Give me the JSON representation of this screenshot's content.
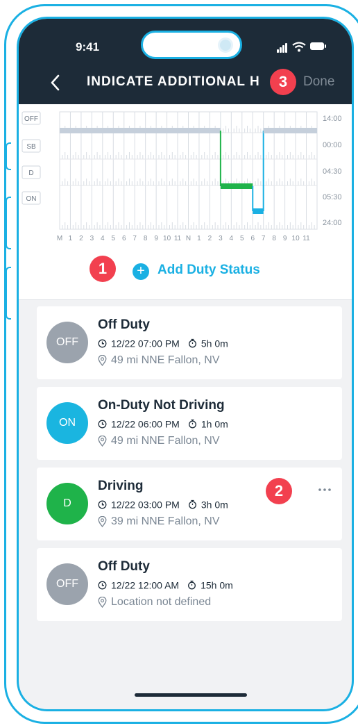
{
  "status_bar": {
    "time": "9:41"
  },
  "nav": {
    "title": "INDICATE ADDITIONAL H",
    "done_label": "Done"
  },
  "badges": [
    "1",
    "2",
    "3"
  ],
  "chart_data": {
    "type": "duty-log",
    "row_labels": [
      "OFF",
      "SB",
      "D",
      "ON"
    ],
    "totals": [
      "14:00",
      "00:00",
      "04:30",
      "05:30",
      "24:00"
    ],
    "x_labels": [
      "M",
      "1",
      "2",
      "3",
      "4",
      "5",
      "6",
      "7",
      "8",
      "9",
      "10",
      "11",
      "N",
      "1",
      "2",
      "3",
      "4",
      "5",
      "6",
      "7",
      "8",
      "9",
      "10",
      "11"
    ],
    "x_range": [
      0,
      24
    ],
    "segments": [
      {
        "status": "OFF",
        "start": 0,
        "end": 15
      },
      {
        "status": "D",
        "start": 15,
        "end": 18
      },
      {
        "status": "ON",
        "start": 18,
        "end": 19
      },
      {
        "status": "OFF",
        "start": 19,
        "end": 24
      }
    ],
    "colors": {
      "OFF": "#c5cfdb",
      "D": "#1fb34a",
      "ON": "#1ab0e3",
      "connector_d": "#1fb34a",
      "connector_on": "#1ab0e3"
    }
  },
  "add_duty": {
    "label": "Add Duty Status",
    "icon": "plus-icon"
  },
  "entries": [
    {
      "badge": "OFF",
      "color": "#9ba3ad",
      "title": "Off Duty",
      "time": "12/22 07:00 PM",
      "duration": "5h 0m",
      "location": "49 mi NNE Fallon, NV",
      "more": false
    },
    {
      "badge": "ON",
      "color": "#1ab5e0",
      "title": "On-Duty Not Driving",
      "time": "12/22 06:00 PM",
      "duration": "1h 0m",
      "location": "49 mi NNE Fallon, NV",
      "more": false
    },
    {
      "badge": "D",
      "color": "#1fb34a",
      "title": "Driving",
      "time": "12/22 03:00 PM",
      "duration": "3h 0m",
      "location": "39 mi NNE Fallon, NV",
      "more": true
    },
    {
      "badge": "OFF",
      "color": "#9ba3ad",
      "title": "Off Duty",
      "time": "12/22 12:00 AM",
      "duration": "15h 0m",
      "location": "Location not defined",
      "more": false
    }
  ]
}
